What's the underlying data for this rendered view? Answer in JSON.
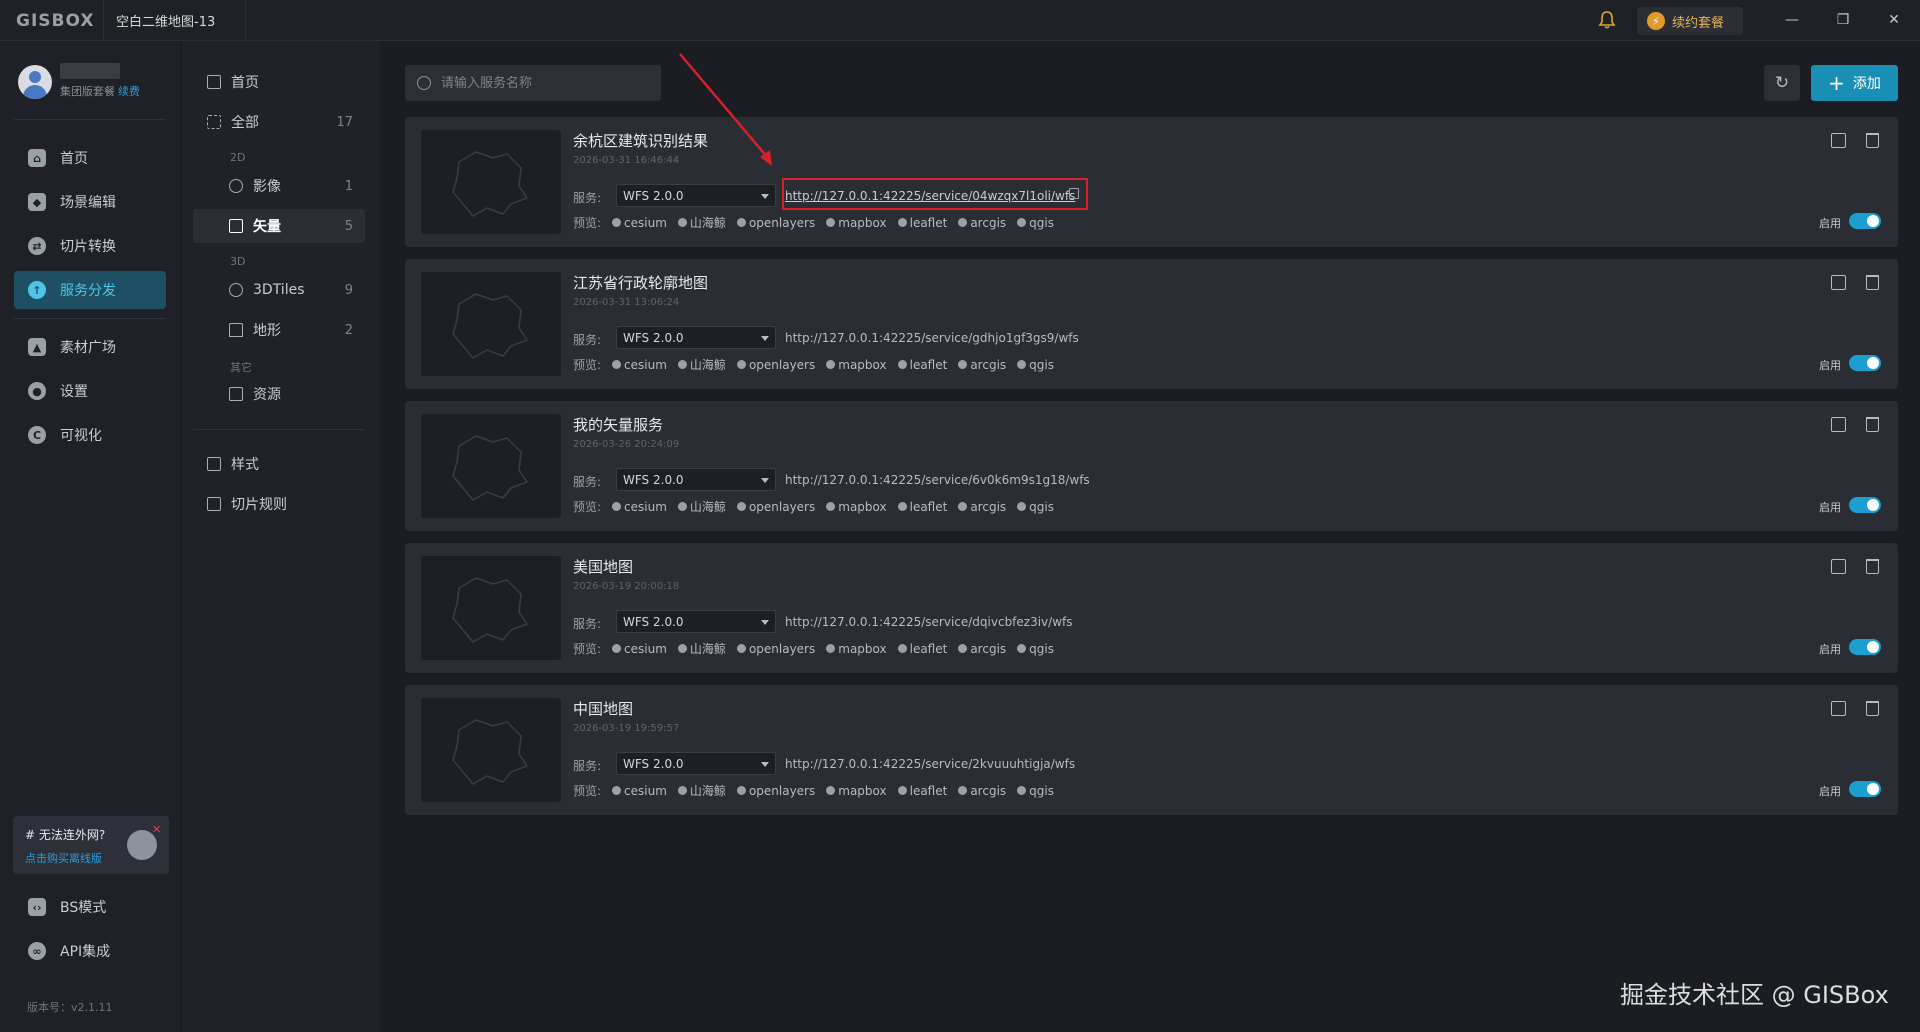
{
  "app": {
    "logo": "GISBOX",
    "tab_title": "空白二维地图-13",
    "renew_label": "续约套餐",
    "win_minimize": "—",
    "win_restore": "❐",
    "win_close": "✕"
  },
  "user": {
    "plan": "集团版套餐",
    "renew_link": "续费"
  },
  "leftnav": {
    "items": [
      {
        "label": "首页",
        "icon": "home-icon"
      },
      {
        "label": "场景编辑",
        "icon": "cube-icon"
      },
      {
        "label": "切片转换",
        "icon": "swap-icon"
      },
      {
        "label": "服务分发",
        "icon": "upload-icon",
        "active": true
      },
      {
        "label": "素材广场",
        "icon": "image-icon"
      },
      {
        "label": "设置",
        "icon": "gear-icon"
      },
      {
        "label": "可视化",
        "icon": "chart-icon"
      }
    ],
    "bottom_items": [
      {
        "label": "BS模式",
        "icon": "code-icon"
      },
      {
        "label": "API集成",
        "icon": "link-icon"
      }
    ],
    "offline_title": "# 无法连外网?",
    "offline_link": "点击购买离线版",
    "offline_close": "✕",
    "version": "版本号：v2.1.11"
  },
  "subnav": {
    "home": "首页",
    "all": {
      "label": "全部",
      "count": "17"
    },
    "group_2d": "2D",
    "imagery": {
      "label": "影像",
      "count": "1"
    },
    "vector": {
      "label": "矢量",
      "count": "5"
    },
    "group_3d": "3D",
    "tiles3d": {
      "label": "3DTiles",
      "count": "9"
    },
    "terrain": {
      "label": "地形",
      "count": "2"
    },
    "group_other": "其它",
    "resource": {
      "label": "资源"
    },
    "style": "样式",
    "tile_rule": "切片规则"
  },
  "toolbar": {
    "search_placeholder": "请输入服务名称",
    "refresh_glyph": "↻",
    "add_label": "添加",
    "add_glyph": "+"
  },
  "labels": {
    "service": "服务:",
    "preview": "预览:",
    "enable": "启用"
  },
  "preview_targets": [
    "cesium",
    "山海鲸",
    "openlayers",
    "mapbox",
    "leaflet",
    "arcgis",
    "qgis"
  ],
  "services": [
    {
      "title": "余杭区建筑识别结果",
      "date": "2026-03-31 16:46:44",
      "version": "WFS 2.0.0",
      "url": "http://127.0.0.1:42225/service/04wzqx7l1oli/wfs",
      "enabled": true
    },
    {
      "title": "江苏省行政轮廓地图",
      "date": "2026-03-31 13:06:24",
      "version": "WFS 2.0.0",
      "url": "http://127.0.0.1:42225/service/gdhjo1gf3gs9/wfs",
      "enabled": true
    },
    {
      "title": "我的矢量服务",
      "date": "2026-03-26 20:24:09",
      "version": "WFS 2.0.0",
      "url": "http://127.0.0.1:42225/service/6v0k6m9s1g18/wfs",
      "enabled": true
    },
    {
      "title": "美国地图",
      "date": "2026-03-19 20:00:18",
      "version": "WFS 2.0.0",
      "url": "http://127.0.0.1:42225/service/dqivcbfez3iv/wfs",
      "enabled": true
    },
    {
      "title": "中国地图",
      "date": "2026-03-19 19:59:57",
      "version": "WFS 2.0.0",
      "url": "http://127.0.0.1:42225/service/2kvuuuhtigja/wfs",
      "enabled": true
    }
  ],
  "watermark": "掘金技术社区 @ GISBox",
  "colors": {
    "accent": "#1a8fb5",
    "active_nav_bg": "#1e4f63",
    "annotation_red": "#d8202a",
    "toggle_on": "#1a9fd0"
  }
}
